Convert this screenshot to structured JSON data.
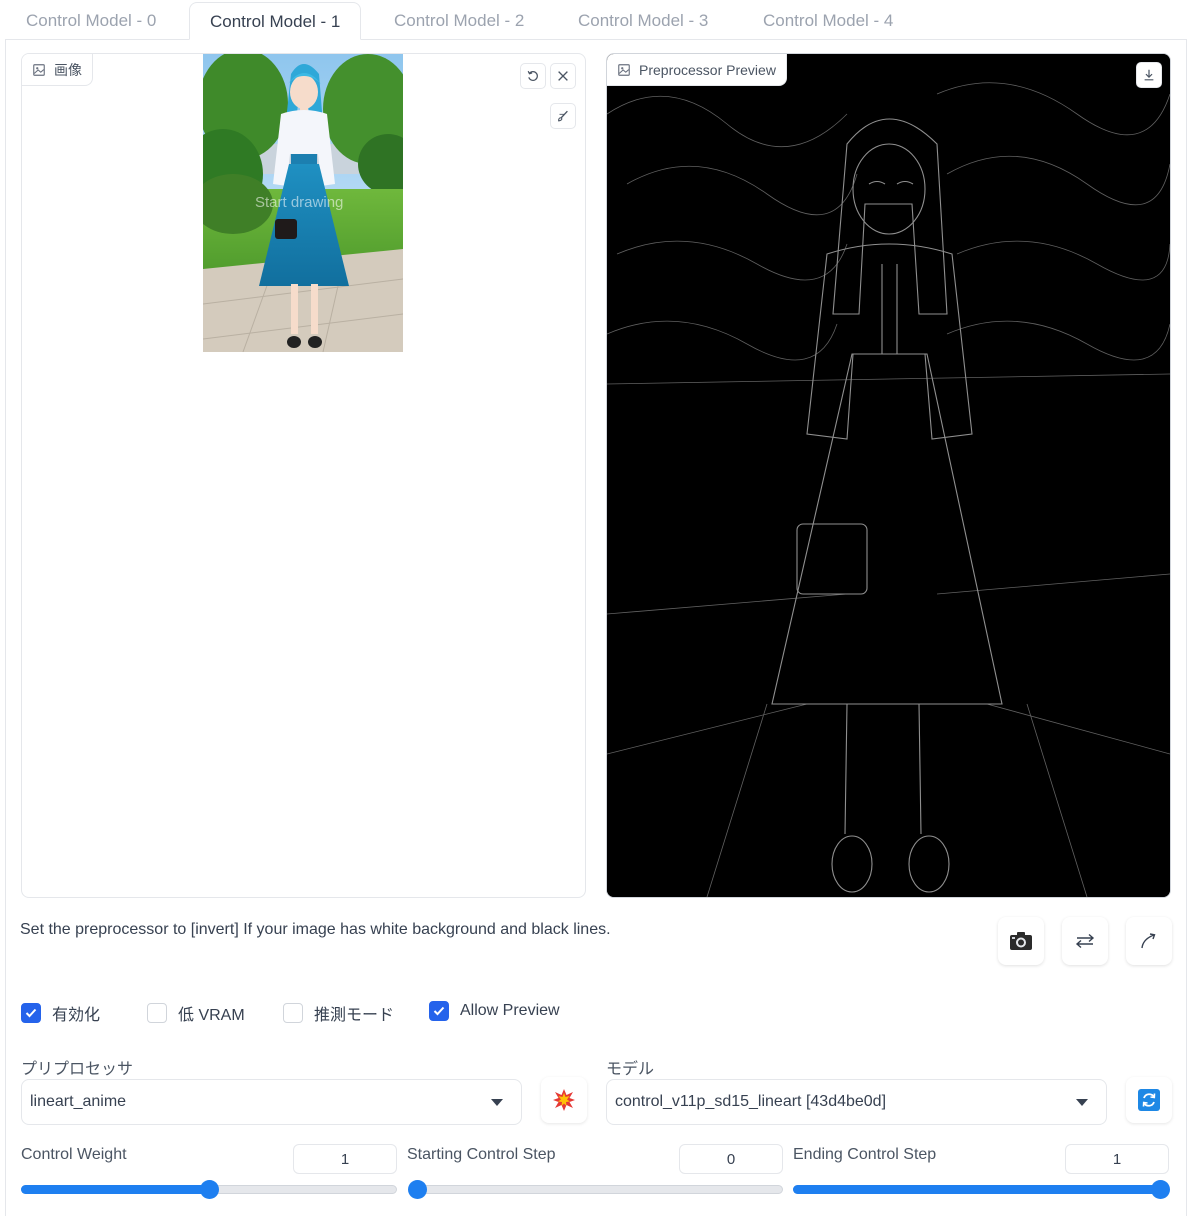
{
  "tabs": [
    {
      "label": "Control Model - 0"
    },
    {
      "label": "Control Model - 1"
    },
    {
      "label": "Control Model - 2"
    },
    {
      "label": "Control Model - 3"
    },
    {
      "label": "Control Model - 4"
    }
  ],
  "active_tab": 1,
  "image_box": {
    "label": "画像",
    "sketch_hint": "Start drawing"
  },
  "preview_box": {
    "label": "Preprocessor Preview"
  },
  "hint_text": "Set the preprocessor to [invert] If your image has white background and black lines.",
  "checkboxes": [
    {
      "label": "有効化",
      "checked": true
    },
    {
      "label": "低 VRAM",
      "checked": false
    },
    {
      "label": "推測モード",
      "checked": false
    },
    {
      "label": "Allow Preview",
      "checked": true
    }
  ],
  "preprocessor": {
    "label": "プリプロセッサ",
    "value": "lineart_anime"
  },
  "model": {
    "label": "モデル",
    "value": "control_v11p_sd15_lineart [43d4be0d]"
  },
  "sliders": [
    {
      "label": "Control Weight",
      "value": "1",
      "fraction": 0.5
    },
    {
      "label": "Starting Control Step",
      "value": "0",
      "fraction": 0.0
    },
    {
      "label": "Ending Control Step",
      "value": "1",
      "fraction": 1.0
    }
  ],
  "colors": {
    "accent": "#2563eb",
    "slider": "#1e7ff0"
  },
  "icons": [
    "image-icon",
    "undo-icon",
    "close-icon",
    "brush-icon",
    "download-icon",
    "camera-icon",
    "swap-icon",
    "send-icon",
    "explosion-icon",
    "refresh-icon"
  ]
}
